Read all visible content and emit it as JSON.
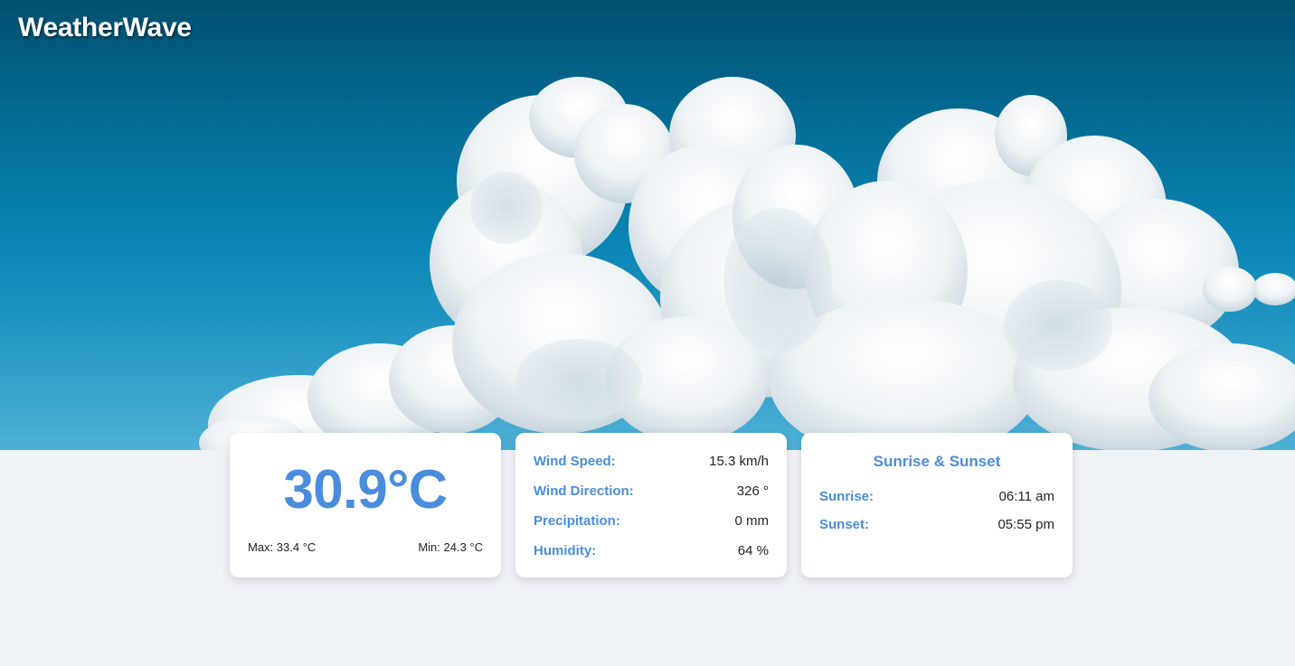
{
  "app": {
    "title": "WeatherWave"
  },
  "colors": {
    "accent": "#4a8ddc",
    "background": "#eff2f7",
    "sky": "#046a93"
  },
  "hero": {
    "image": "cloud-sky-image"
  },
  "temperature": {
    "current": "30.9°C",
    "max": "Max: 33.4 °C",
    "min": "Min: 24.3 °C"
  },
  "conditions": {
    "wind_speed": {
      "label": "Wind Speed:",
      "value": "15.3 km/h"
    },
    "wind_direction": {
      "label": "Wind Direction:",
      "value": "326 °"
    },
    "precipitation": {
      "label": "Precipitation:",
      "value": "0 mm"
    },
    "humidity": {
      "label": "Humidity:",
      "value": "64 %"
    }
  },
  "sun": {
    "title": "Sunrise & Sunset",
    "sunrise": {
      "label": "Sunrise:",
      "value": "06:11 am"
    },
    "sunset": {
      "label": "Sunset:",
      "value": "05:55 pm"
    }
  }
}
